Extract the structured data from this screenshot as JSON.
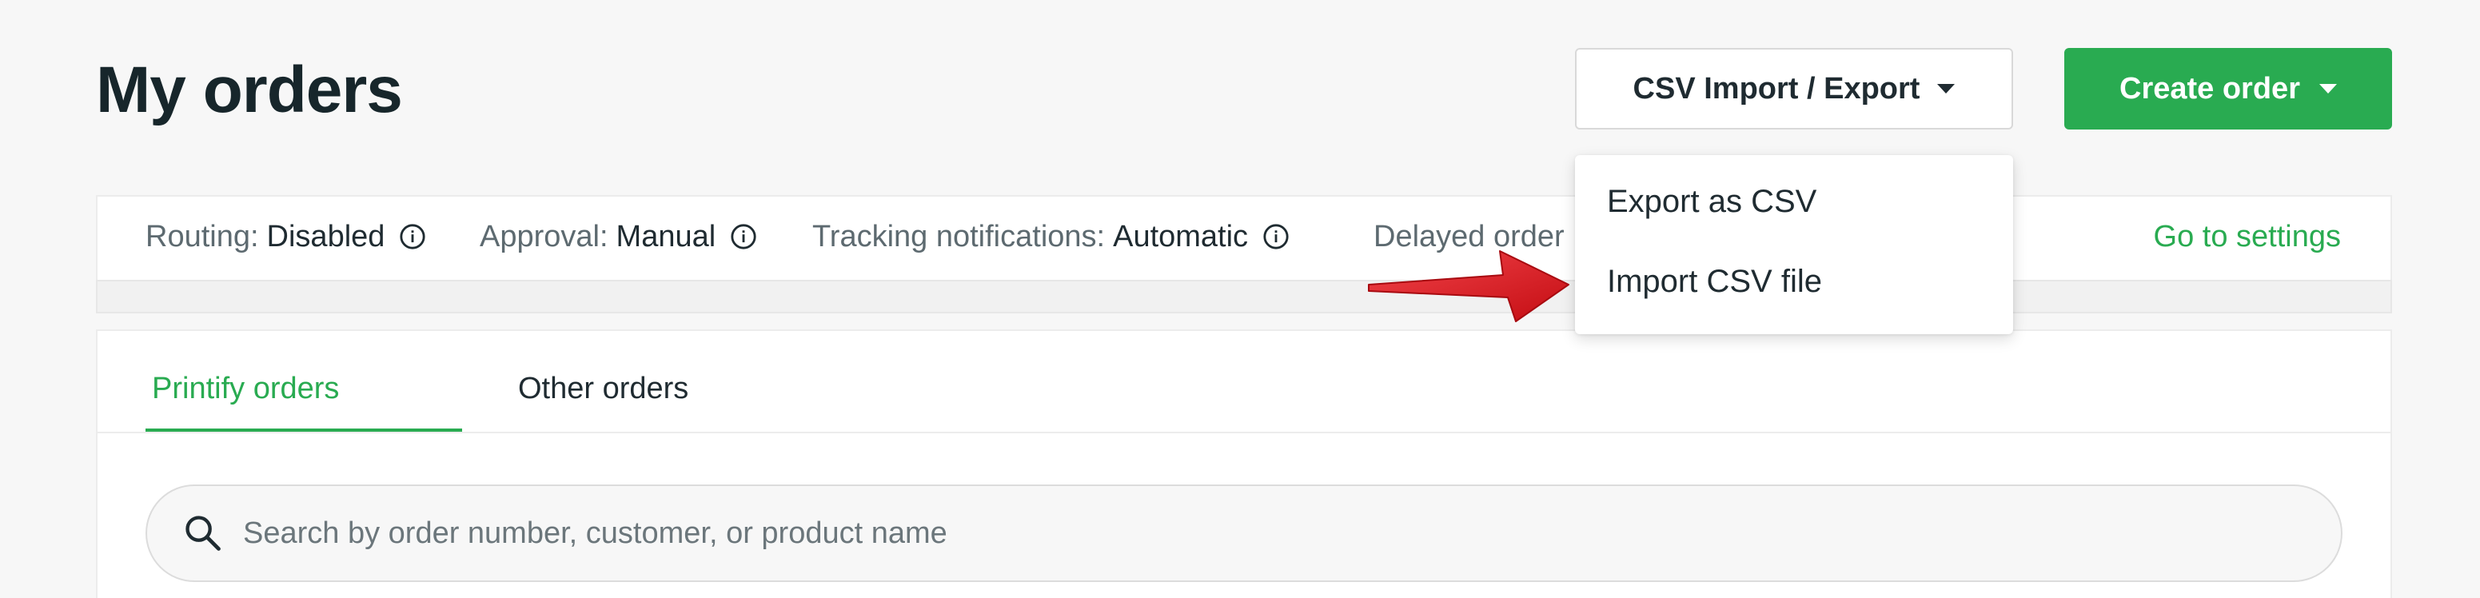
{
  "header": {
    "title": "My orders",
    "csv_button_label": "CSV Import / Export",
    "create_button_label": "Create order"
  },
  "settings_bar": {
    "routing_label": "Routing:",
    "routing_value": "Disabled",
    "approval_label": "Approval:",
    "approval_value": "Manual",
    "tracking_label": "Tracking notifications:",
    "tracking_value": "Automatic",
    "delayed_label": "Delayed order",
    "go_to_settings": "Go to settings"
  },
  "tabs": [
    {
      "label": "Printify orders",
      "active": true
    },
    {
      "label": "Other orders",
      "active": false
    }
  ],
  "search": {
    "placeholder": "Search by order number, customer, or product name",
    "value": ""
  },
  "csv_menu": {
    "items": [
      {
        "label": "Export as CSV"
      },
      {
        "label": "Import CSV file"
      }
    ]
  },
  "annotation": {
    "arrow_color": "#e3161d",
    "icon": "red-pointer-arrow"
  },
  "colors": {
    "accent": "#29ab51",
    "background": "#f7f7f7",
    "text": "#1f2b31",
    "muted": "#5d6a70"
  }
}
